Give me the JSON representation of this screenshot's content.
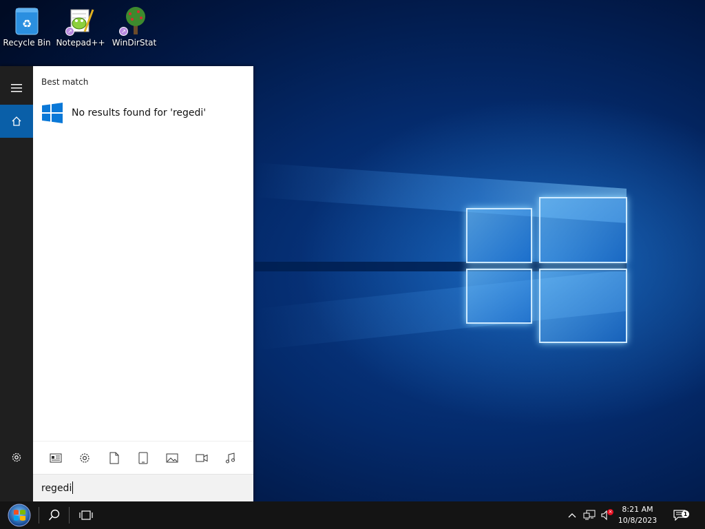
{
  "desktop": {
    "icons": [
      {
        "label": "Recycle Bin"
      },
      {
        "label": "Notepad++"
      },
      {
        "label": "WinDirStat"
      }
    ]
  },
  "start_menu": {
    "section_title": "Best match",
    "result_text": "No results found for 'regedi'",
    "search_value": "regedi",
    "accent_color": "#0a5fa8"
  },
  "taskbar": {
    "time": "8:21 AM",
    "date": "10/8/2023",
    "notification_count": "1"
  }
}
